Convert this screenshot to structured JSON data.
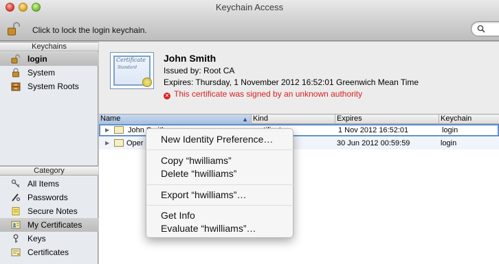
{
  "window": {
    "title": "Keychain Access"
  },
  "toolbar": {
    "lock_text": "Click to lock the login keychain.",
    "search_icon": "magnifier-icon"
  },
  "sidebar": {
    "keychains_header": "Keychains",
    "keychains": [
      {
        "label": "login",
        "icon": "padlock-open-icon",
        "selected": true
      },
      {
        "label": "System",
        "icon": "padlock-closed-icon",
        "selected": false
      },
      {
        "label": "System Roots",
        "icon": "cabinet-icon",
        "selected": false
      }
    ],
    "category_header": "Category",
    "categories": [
      {
        "label": "All Items",
        "icon": "keys-icon",
        "selected": false
      },
      {
        "label": "Passwords",
        "icon": "pen-key-icon",
        "selected": false
      },
      {
        "label": "Secure Notes",
        "icon": "note-icon",
        "selected": false
      },
      {
        "label": "My Certificates",
        "icon": "certificate-person-icon",
        "selected": true
      },
      {
        "label": "Keys",
        "icon": "key-icon",
        "selected": false
      },
      {
        "label": "Certificates",
        "icon": "certificate-icon",
        "selected": false
      }
    ]
  },
  "certificate": {
    "image_words": [
      "Certificate",
      "Standard"
    ],
    "name": "John Smith",
    "issued_by": "Issued by: Root CA",
    "expires": "Expires: Thursday, 1 November 2012 16:52:01 Greenwich Mean Time",
    "warning": "This certificate was signed by an unknown authority",
    "warning_color": "#d92020"
  },
  "table": {
    "columns": [
      "Name",
      "Kind",
      "Expires",
      "Keychain"
    ],
    "sort_indicator": "▲",
    "rows": [
      {
        "name": "John Smith",
        "kind": "certificate",
        "expires": "1 Nov 2012 16:52:01",
        "keychain": "login"
      },
      {
        "name": "Oper",
        "kind": "",
        "expires": "30 Jun 2012 00:59:59",
        "keychain": "login"
      }
    ]
  },
  "context_menu": {
    "items": [
      "New Identity Preference…",
      "Copy “hwilliams”",
      "Delete “hwilliams”",
      "Export “hwilliams”…",
      "Get Info",
      "Evaluate “hwilliams”…"
    ]
  }
}
